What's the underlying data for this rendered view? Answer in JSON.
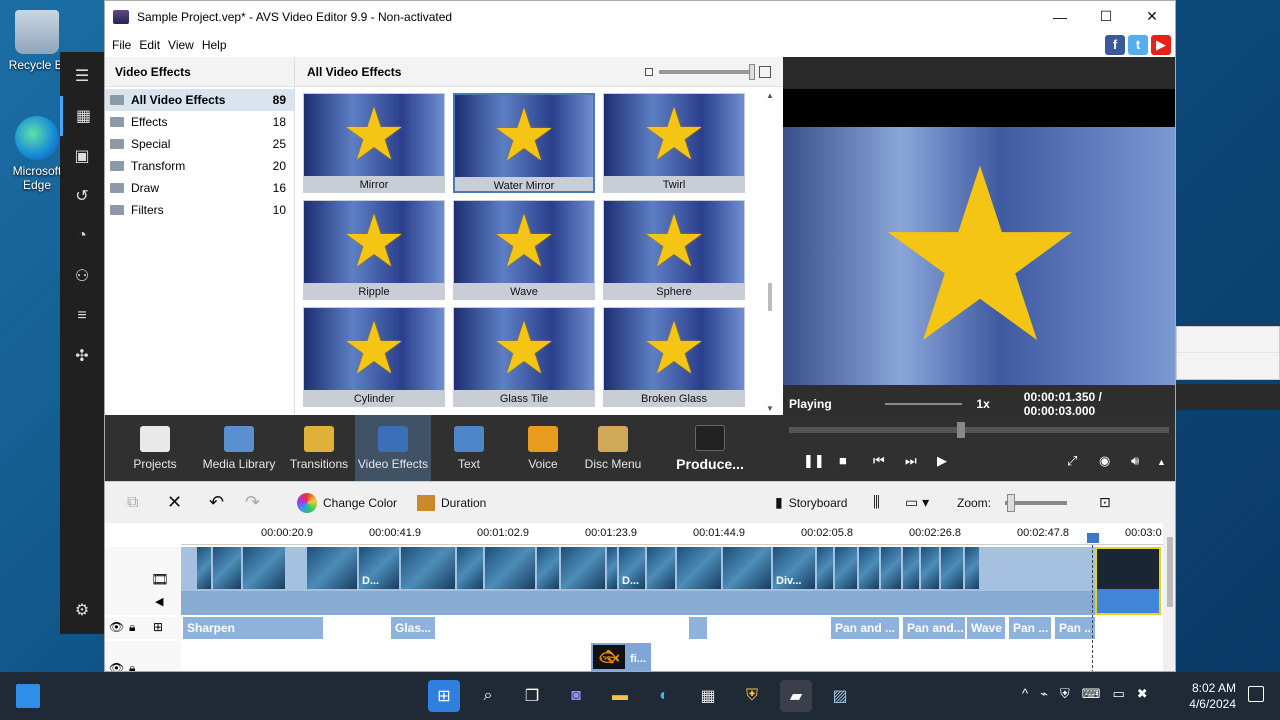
{
  "desktop": {
    "icons": [
      {
        "label": "Recycle Bi"
      },
      {
        "label": "Microsoft Edge"
      }
    ]
  },
  "window": {
    "title": "Sample Project.vep* - AVS Video Editor 9.9 - Non-activated",
    "minimize": "—",
    "maximize": "☐",
    "close": "✕"
  },
  "menu": {
    "file": "File",
    "edit": "Edit",
    "view": "View",
    "help": "Help",
    "social": [
      {
        "name": "facebook-icon",
        "glyph": "f",
        "color": "#3b5998"
      },
      {
        "name": "twitter-icon",
        "glyph": "t",
        "color": "#55acee"
      },
      {
        "name": "youtube-icon",
        "glyph": "▶",
        "color": "#e62117"
      }
    ]
  },
  "categories": {
    "heading": "Video Effects",
    "items": [
      {
        "label": "All Video Effects",
        "count": "89",
        "selected": true
      },
      {
        "label": "Effects",
        "count": "18"
      },
      {
        "label": "Special",
        "count": "25"
      },
      {
        "label": "Transform",
        "count": "20"
      },
      {
        "label": "Draw",
        "count": "16"
      },
      {
        "label": "Filters",
        "count": "10"
      }
    ]
  },
  "effects": {
    "heading": "All Video Effects",
    "tiles": [
      {
        "label": "Mirror"
      },
      {
        "label": "Water Mirror",
        "selected": true
      },
      {
        "label": "Twirl"
      },
      {
        "label": "Ripple"
      },
      {
        "label": "Wave"
      },
      {
        "label": "Sphere"
      },
      {
        "label": "Cylinder"
      },
      {
        "label": "Glass Tile"
      },
      {
        "label": "Broken Glass"
      }
    ]
  },
  "preview": {
    "state": "Playing",
    "speed": "1x",
    "time": "00:00:01.350 / 00:00:03.000"
  },
  "toolbar": {
    "items": [
      {
        "label": "Projects",
        "color": "#e9e9e9"
      },
      {
        "label": "Media Library",
        "color": "#5a8fd0"
      },
      {
        "label": "Transitions",
        "color": "#e0b13a"
      },
      {
        "label": "Video Effects",
        "color": "#3b6fb6",
        "selected": true
      },
      {
        "label": "Text",
        "color": "#4e86c9"
      },
      {
        "label": "Voice",
        "color": "#e89b1e"
      },
      {
        "label": "Disc Menu",
        "color": "#cfa85a"
      }
    ],
    "produce": "Produce..."
  },
  "timeline_tools": {
    "change_color": "Change Color",
    "duration": "Duration",
    "storyboard": "Storyboard",
    "zoom": "Zoom:"
  },
  "timeline": {
    "ruler": [
      "00:00:20.9",
      "00:00:41.9",
      "00:01:02.9",
      "00:01:23.9",
      "00:01:44.9",
      "00:02:05.8",
      "00:02:26.8",
      "00:02:47.8",
      "00:03:0"
    ],
    "clip_labels": [
      "D...",
      "D...",
      "Div..."
    ],
    "effects": [
      {
        "label": "Sharpen"
      },
      {
        "label": "Glas..."
      },
      {
        "label": ""
      },
      {
        "label": "Pan and ..."
      },
      {
        "label": "Pan and..."
      },
      {
        "label": "Wave"
      },
      {
        "label": "Pan ..."
      },
      {
        "label": "Pan ..."
      }
    ],
    "overlay_label": "fi..."
  },
  "taskbar": {
    "time": "8:02 AM",
    "date": "4/6/2024"
  }
}
